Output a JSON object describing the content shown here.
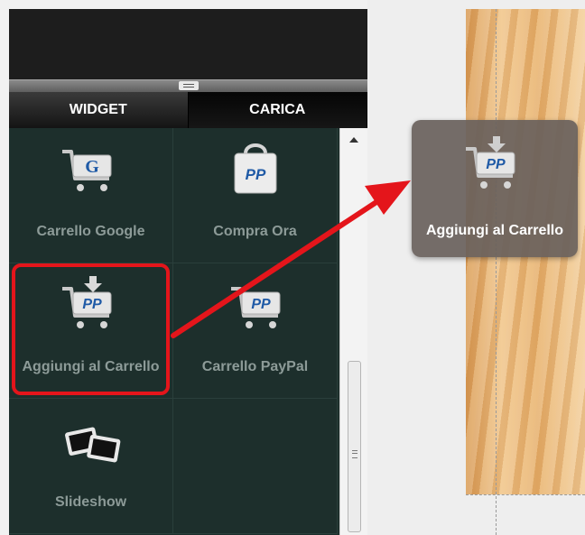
{
  "tabs": [
    {
      "label": "WIDGET",
      "active": false
    },
    {
      "label": "CARICA",
      "active": true
    }
  ],
  "widgets": [
    {
      "label": "Carrello Google",
      "icon": "google-cart-icon"
    },
    {
      "label": "Compra Ora",
      "icon": "paypal-bag-icon"
    },
    {
      "label": "Aggiungi al Carrello",
      "icon": "paypal-add-to-cart-icon",
      "highlighted": true
    },
    {
      "label": "Carrello PayPal",
      "icon": "paypal-cart-icon"
    },
    {
      "label": "Slideshow",
      "icon": "slideshow-icon"
    }
  ],
  "drag_preview": {
    "label": "Aggiungi al Carrello",
    "icon": "paypal-add-to-cart-icon"
  },
  "icon_text": {
    "google": "G",
    "paypal": "PP"
  },
  "colors": {
    "highlight": "#e4151b",
    "arrow": "#e4151b",
    "panel": "#1d2f2c",
    "paypal_blue": "#1f5aa6"
  }
}
